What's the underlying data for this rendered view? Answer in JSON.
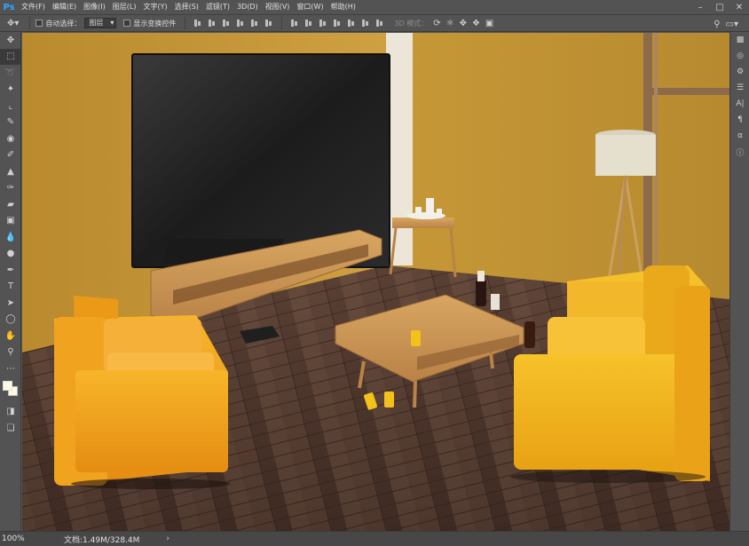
{
  "app": {
    "logo": "Ps"
  },
  "menu": [
    "文件(F)",
    "编辑(E)",
    "图像(I)",
    "图层(L)",
    "文字(Y)",
    "选择(S)",
    "滤镜(T)",
    "3D(D)",
    "视图(V)",
    "窗口(W)",
    "帮助(H)"
  ],
  "options": {
    "auto_select_label": "自动选择：",
    "auto_select_value": "图层",
    "show_transform_label": "显示变换控件",
    "mode_3d_label": "3D 模式："
  },
  "status": {
    "zoom": "100%",
    "doc_info": "文档:1.49M/328.4M",
    "arrow": "›"
  },
  "colors": {
    "accent_logo": "#31a8ff",
    "wall": "#c9993c",
    "sofa": "#f2a71c",
    "floor": "#4a3328",
    "foreground_swatch": "#fff9e3",
    "background_swatch": "#fff9e3"
  },
  "icons": {
    "tools": [
      "move-icon",
      "marquee-icon",
      "lasso-icon",
      "magic-wand-icon",
      "crop-icon",
      "eyedropper-icon",
      "healing-brush-icon",
      "brush-icon",
      "stamp-icon",
      "history-brush-icon",
      "eraser-icon",
      "gradient-icon",
      "blur-icon",
      "dodge-icon",
      "pen-icon",
      "type-icon",
      "path-selection-icon",
      "ellipse-icon",
      "hand-icon",
      "zoom-icon",
      "more-icon"
    ],
    "right": [
      "layers-icon",
      "channels-icon",
      "properties-icon",
      "adjustments-icon",
      "character-icon",
      "paragraph-icon",
      "glyphs-icon",
      "info-icon"
    ]
  }
}
